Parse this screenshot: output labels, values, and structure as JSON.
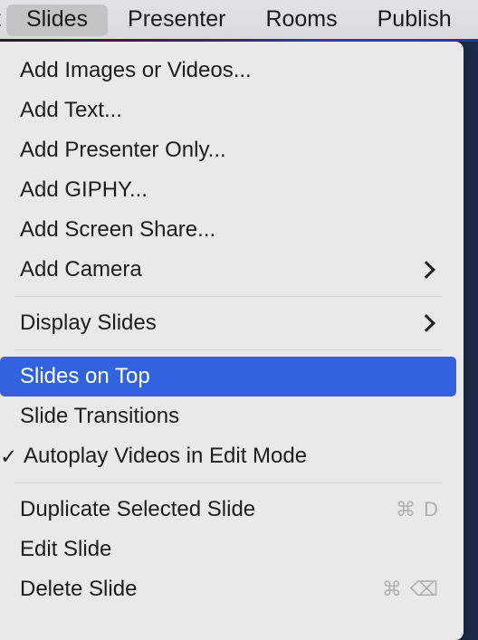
{
  "menubar": {
    "items": [
      {
        "label": "t",
        "active": false,
        "clipped": true
      },
      {
        "label": "Slides",
        "active": true,
        "clipped": false
      },
      {
        "label": "Presenter",
        "active": false,
        "clipped": false
      },
      {
        "label": "Rooms",
        "active": false,
        "clipped": false
      },
      {
        "label": "Publish",
        "active": false,
        "clipped": false
      }
    ]
  },
  "colors": {
    "menu_background": "#e9e9e9",
    "highlight_blue": "#3063dd",
    "menubar_background": "#dedee0",
    "active_tab_background": "#c3c3c4",
    "separator": "#cfcfcf",
    "shortcut_text": "#b0b0b0",
    "item_text": "#1d1d1d",
    "selected_item_text": "#ffffff"
  },
  "menu": {
    "title": "Slides",
    "groups": [
      {
        "items": [
          {
            "label": "Add Images or Videos...",
            "checked": false,
            "submenu": false,
            "selected": false,
            "shortcut": null
          },
          {
            "label": "Add Text...",
            "checked": false,
            "submenu": false,
            "selected": false,
            "shortcut": null
          },
          {
            "label": "Add Presenter Only...",
            "checked": false,
            "submenu": false,
            "selected": false,
            "shortcut": null
          },
          {
            "label": "Add GIPHY...",
            "checked": false,
            "submenu": false,
            "selected": false,
            "shortcut": null
          },
          {
            "label": "Add Screen Share...",
            "checked": false,
            "submenu": false,
            "selected": false,
            "shortcut": null
          },
          {
            "label": "Add Camera",
            "checked": false,
            "submenu": true,
            "selected": false,
            "shortcut": null
          }
        ]
      },
      {
        "items": [
          {
            "label": "Display Slides",
            "checked": false,
            "submenu": true,
            "selected": false,
            "shortcut": null
          }
        ]
      },
      {
        "items": [
          {
            "label": "Slides on Top",
            "checked": false,
            "submenu": false,
            "selected": true,
            "shortcut": null
          },
          {
            "label": "Slide Transitions",
            "checked": false,
            "submenu": false,
            "selected": false,
            "shortcut": null
          },
          {
            "label": "Autoplay Videos in Edit Mode",
            "checked": true,
            "submenu": false,
            "selected": false,
            "shortcut": null
          }
        ]
      },
      {
        "items": [
          {
            "label": "Duplicate Selected Slide",
            "checked": false,
            "submenu": false,
            "selected": false,
            "shortcut": {
              "modifier": "⌘",
              "key": "D"
            }
          },
          {
            "label": "Edit Slide",
            "checked": false,
            "submenu": false,
            "selected": false,
            "shortcut": null
          },
          {
            "label": "Delete Slide",
            "checked": false,
            "submenu": false,
            "selected": false,
            "shortcut": {
              "modifier": "⌘",
              "key": "⌫"
            }
          }
        ]
      }
    ]
  },
  "icons": {
    "checkmark": "✓",
    "chevron_right": "›",
    "command_key": "⌘",
    "delete_key": "⌫"
  }
}
